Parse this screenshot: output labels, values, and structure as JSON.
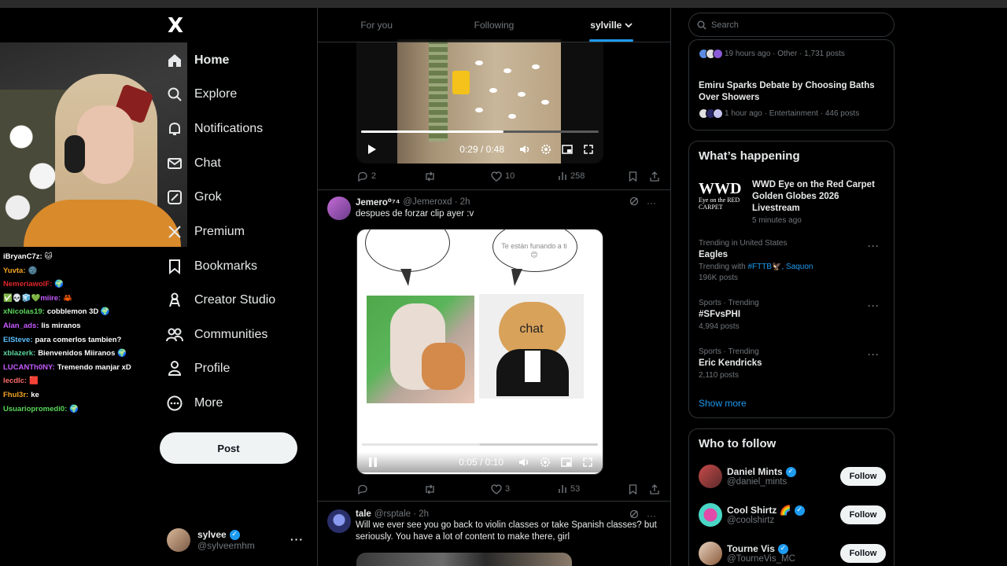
{
  "colors": {
    "background": "#000000",
    "accent": "#1d9bf0",
    "text_primary": "#e7e9ea",
    "text_secondary": "#71767b",
    "border": "#2f3336"
  },
  "stream_chat": [
    {
      "user": "iBryanC7z:",
      "user_color": "#ffffff",
      "msg": "🐱"
    },
    {
      "user": "Yuvta:",
      "user_color": "#f5a623",
      "msg": "🌚"
    },
    {
      "user": "NemeriawolF:",
      "user_color": "#e0262b",
      "msg": "🌍"
    },
    {
      "user": "✅💀🧊💚miire:",
      "user_color": "#c65bff",
      "msg": "🦀"
    },
    {
      "user": "xNicolas19:",
      "user_color": "#5bd65b",
      "msg": "cobblemon 3D 🌍"
    },
    {
      "user": "Alan_ads:",
      "user_color": "#c65bff",
      "msg": "lis miranos"
    },
    {
      "user": "ElSteve:",
      "user_color": "#5bc0ff",
      "msg": "para comerlos tambien?"
    },
    {
      "user": "xblazerk:",
      "user_color": "#5bd6a0",
      "msg": "Bienvenidos Miiranos 🌍"
    },
    {
      "user": "LUCANTh0NY:",
      "user_color": "#c65bff",
      "msg": "Tremendo manjar xD"
    },
    {
      "user": "lecdlc:",
      "user_color": "#ff6b6b",
      "msg": "🟥"
    },
    {
      "user": "Fhul3r:",
      "user_color": "#f5a623",
      "msg": "ke"
    },
    {
      "user": "Usuariopromedi0:",
      "user_color": "#5bd65b",
      "msg": "🌍"
    }
  ],
  "nav": {
    "logo": "X",
    "items": [
      {
        "label": "Home",
        "icon": "home-icon"
      },
      {
        "label": "Explore",
        "icon": "search-icon"
      },
      {
        "label": "Notifications",
        "icon": "bell-icon"
      },
      {
        "label": "Chat",
        "icon": "mail-icon"
      },
      {
        "label": "Grok",
        "icon": "grok-icon"
      },
      {
        "label": "Premium",
        "icon": "x-icon"
      },
      {
        "label": "Bookmarks",
        "icon": "bookmark-icon"
      },
      {
        "label": "Creator Studio",
        "icon": "creator-icon"
      },
      {
        "label": "Communities",
        "icon": "communities-icon"
      },
      {
        "label": "Profile",
        "icon": "person-icon"
      },
      {
        "label": "More",
        "icon": "more-circle-icon"
      }
    ],
    "post_label": "Post"
  },
  "account": {
    "display_name": "sylvee",
    "handle": "@sylveemhm",
    "more": "···"
  },
  "tabs": [
    {
      "label": "For you",
      "active": false
    },
    {
      "label": "Following",
      "active": false
    },
    {
      "label": "sylville",
      "active": true
    }
  ],
  "feed": {
    "tweet1": {
      "video_time": "0:29 / 0:48",
      "progress": 0.6,
      "replies": "2",
      "reposts": "",
      "likes": "10",
      "views": "258"
    },
    "tweet2": {
      "name": "Jemero⁰⁷⁴",
      "handle": "@Jemeroxd · 2h",
      "text": "despues de forzar clip ayer :v",
      "meme_bubble_text": "Te están funando a ti 😊",
      "meme_cat_text": "chat",
      "video_time": "0:05 / 0:10",
      "progress": 0.5,
      "replies": "",
      "reposts": "",
      "likes": "3",
      "views": "53"
    },
    "tweet3": {
      "name": "tale",
      "handle": "@rsptale · 2h",
      "text": "Will we ever see you go back to violin classes or take Spanish classes? but seriously. You have a lot of content to make there, girl"
    }
  },
  "search": {
    "placeholder": "Search"
  },
  "news_top": {
    "item1_meta": "19 hours ago · Other · 1,731 posts",
    "item2_title": "Emiru Sparks Debate by Choosing Baths Over Showers",
    "item2_meta": "1 hour ago · Entertainment · 446 posts"
  },
  "whats_happening": {
    "title": "What’s happening",
    "featured": {
      "logo_main": "WWD",
      "logo_sub": "Eye on the RED CARPET",
      "title": "WWD Eye on the Red Carpet Golden Globes 2026 Livestream",
      "time": "5 minutes ago"
    },
    "trends": [
      {
        "context": "Trending in United States",
        "name": "Eagles",
        "with_label": "Trending with",
        "with_links": "#FTTB🦅, Saquon",
        "count": "196K posts"
      },
      {
        "context": "Sports · Trending",
        "name": "#SFvsPHI",
        "count": "4,994 posts"
      },
      {
        "context": "Sports · Trending",
        "name": "Eric Kendricks",
        "count": "2,110 posts"
      }
    ],
    "show_more": "Show more"
  },
  "who_to_follow": {
    "title": "Who to follow",
    "accounts": [
      {
        "name": "Daniel Mints",
        "handle": "@daniel_mints",
        "button": "Follow"
      },
      {
        "name": "Cool Shirtz 🌈",
        "handle": "@coolshirtz",
        "button": "Follow"
      },
      {
        "name": "Tourne Vis",
        "handle": "@TourneVis_MC",
        "button": "Follow"
      }
    ]
  }
}
